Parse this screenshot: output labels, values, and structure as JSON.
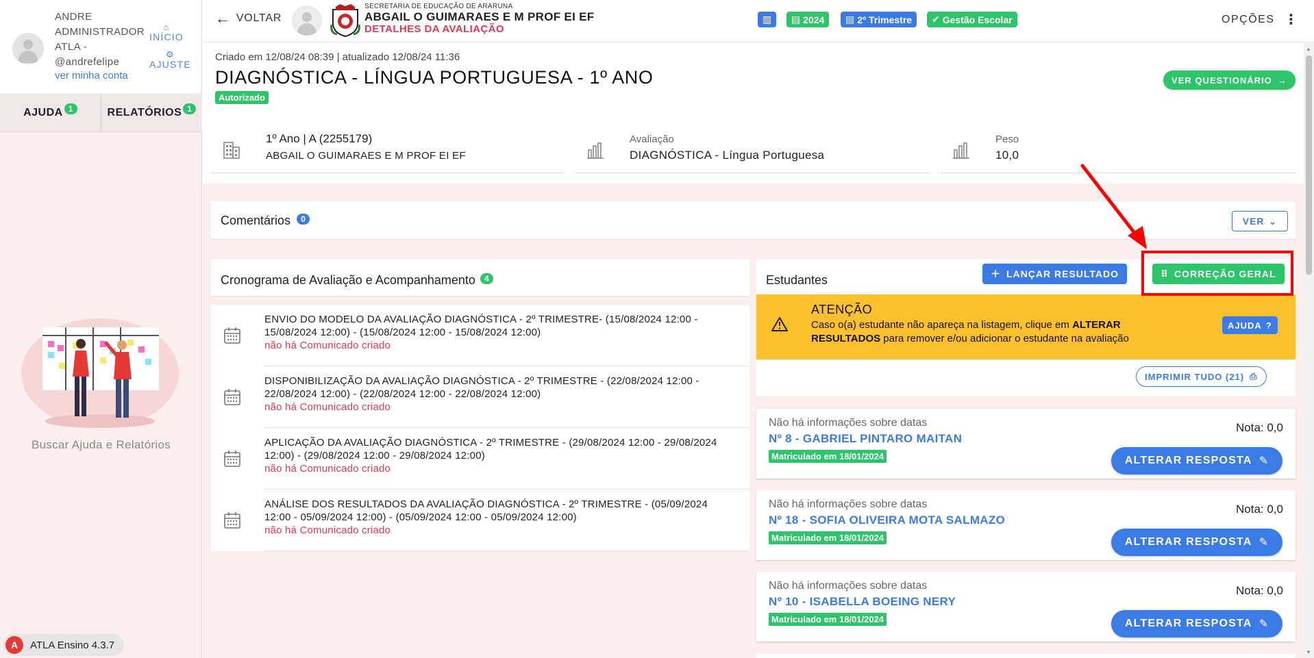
{
  "sidebar": {
    "user_name": "ANDRE ADMINISTRADOR ATLA - @andrefelipe",
    "account_link": "ver minha conta",
    "nav_inicio": "INÍCIO",
    "nav_ajuste": "AJUSTE",
    "tab_ajuda": "AJUDA",
    "tab_ajuda_count": "1",
    "tab_relatorios": "RELATÓRIOS",
    "tab_relatorios_count": "1",
    "help_text": "Buscar Ajuda e Relatórios",
    "version": "ATLA Ensino 4.3.7"
  },
  "header": {
    "back": "VOLTAR",
    "secretaria": "SECRETARIA DE EDUCAÇÃO DE ARARUNA",
    "school": "ABGAIL O GUIMARAES E M PROF EI EF",
    "page_title": "DETALHES DA AVALIAÇÃO",
    "chip_year": "2024",
    "chip_trimestre": "2º Trimestre",
    "chip_gestao": "Gestão Escolar",
    "options": "OPÇÕES"
  },
  "evaluation": {
    "meta": "Criado em 12/08/24 08:39 | atualizado 12/08/24 11:36",
    "title": "DIAGNÓSTICA - LÍNGUA PORTUGUESA - 1º ANO",
    "status": "Autorizado",
    "btn_questionario": "VER QUESTIONÁRIO",
    "class": "1º Ano | A (2255179)",
    "class_school": "ABGAIL O GUIMARAES E M PROF EI EF",
    "avaliacao_label": "Avaliação",
    "avaliacao_value": "DIAGNÓSTICA - Língua Portuguesa",
    "peso_label": "Peso",
    "peso_value": "10,0"
  },
  "comments": {
    "title": "Comentários",
    "count": "0",
    "btn_ver": "VER"
  },
  "cronograma": {
    "title": "Cronograma de Avaliação e Acompanhamento",
    "count": "4",
    "items": [
      {
        "text": "ENVIO DO MODELO DA AVALIAÇÃO DIAGNÓSTICA - 2º TRIMESTRE- (15/08/2024 12:00 - 15/08/2024 12:00) - (15/08/2024 12:00 - 15/08/2024 12:00)",
        "status": "não há Comunicado criado"
      },
      {
        "text": "DISPONIBILIZAÇÃO DA AVALIAÇÃO DIAGNÓSTICA - 2º TRIMESTRE - (22/08/2024 12:00 - 22/08/2024 12:00) - (22/08/2024 12:00 - 22/08/2024 12:00)",
        "status": "não há Comunicado criado"
      },
      {
        "text": "APLICAÇÃO DA AVALIAÇÃO DIAGNÓSTICA - 2º TRIMESTRE - (29/08/2024 12:00 - 29/08/2024 12:00) - (29/08/2024 12:00 - 29/08/2024 12:00)",
        "status": "não há Comunicado criado"
      },
      {
        "text": "ANÁLISE DOS RESULTADOS DA AVALIAÇÃO DIAGNÓSTICA - 2º TRIMESTRE - (05/09/2024 12:00 - 05/09/2024 12:00) - (05/09/2024 12:00 - 05/09/2024 12:00)",
        "status": "não há Comunicado criado"
      }
    ]
  },
  "students": {
    "title": "Estudantes",
    "btn_lancar": "LANÇAR RESULTADO",
    "btn_correcao": "CORREÇÃO GERAL",
    "alert_title": "ATENÇÃO",
    "alert_pre": "Caso o(a) estudante não apareça na listagem, clique em ",
    "alert_bold": "ALTERAR RESULTADOS",
    "alert_post": " para remover e/ou adicionar o estudante na avaliação",
    "btn_ajuda": "AJUDA",
    "btn_print": "IMPRIMIR TUDO (21)",
    "list": [
      {
        "dates": "Não há informações sobre datas",
        "name": "Nº 8 - GABRIEL PINTARO MAITAN",
        "enrolled": "Matriculado em 18/01/2024",
        "grade": "Nota: 0,0",
        "action": "ALTERAR RESPOSTA"
      },
      {
        "dates": "Não há informações sobre datas",
        "name": "Nº 18 - SOFIA OLIVEIRA MOTA SALMAZO",
        "enrolled": "Matriculado em 18/01/2024",
        "grade": "Nota: 0,0",
        "action": "ALTERAR RESPOSTA"
      },
      {
        "dates": "Não há informações sobre datas",
        "name": "Nº 10 - ISABELLA BOEING NERY",
        "enrolled": "Matriculado em 18/01/2024",
        "grade": "Nota: 0,0",
        "action": "ALTERAR RESPOSTA"
      }
    ]
  },
  "colors": {
    "primary": "#3b7be6",
    "success": "#2ec56a",
    "danger": "#e53950",
    "warning": "#fbc02d",
    "highlight": "#ff0000"
  }
}
